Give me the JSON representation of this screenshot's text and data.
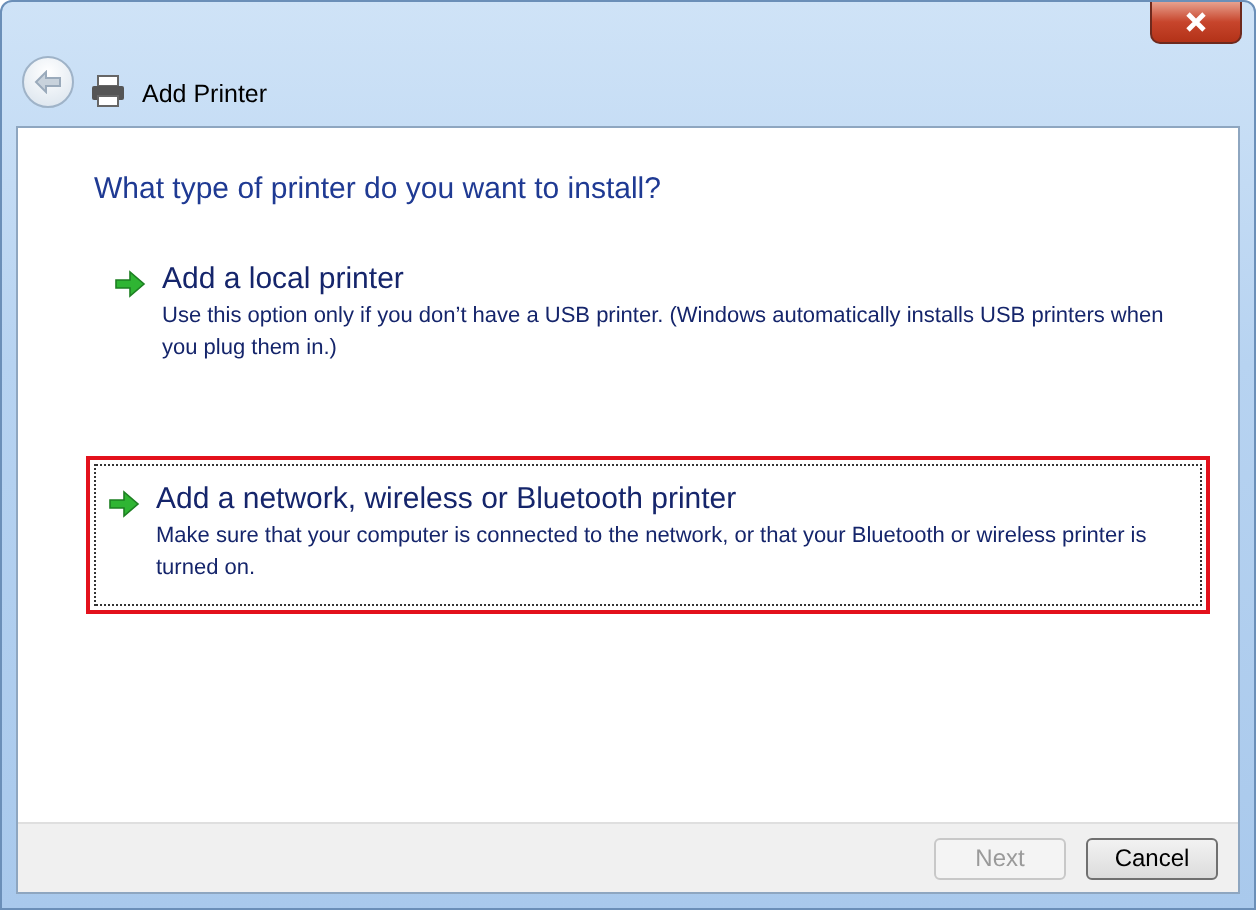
{
  "window": {
    "title": "Add Printer"
  },
  "heading": "What type of printer do you want to install?",
  "options": [
    {
      "title": "Add a local printer",
      "description": "Use this option only if you don’t have a USB printer. (Windows automatically installs USB printers when you plug them in.)",
      "selected": false
    },
    {
      "title": "Add a network, wireless or Bluetooth printer",
      "description": "Make sure that your computer is connected to the network, or that your Bluetooth or wireless printer is turned on.",
      "selected": true
    }
  ],
  "buttons": [
    {
      "label": "Next",
      "disabled": true
    },
    {
      "label": "Cancel",
      "disabled": false
    }
  ]
}
